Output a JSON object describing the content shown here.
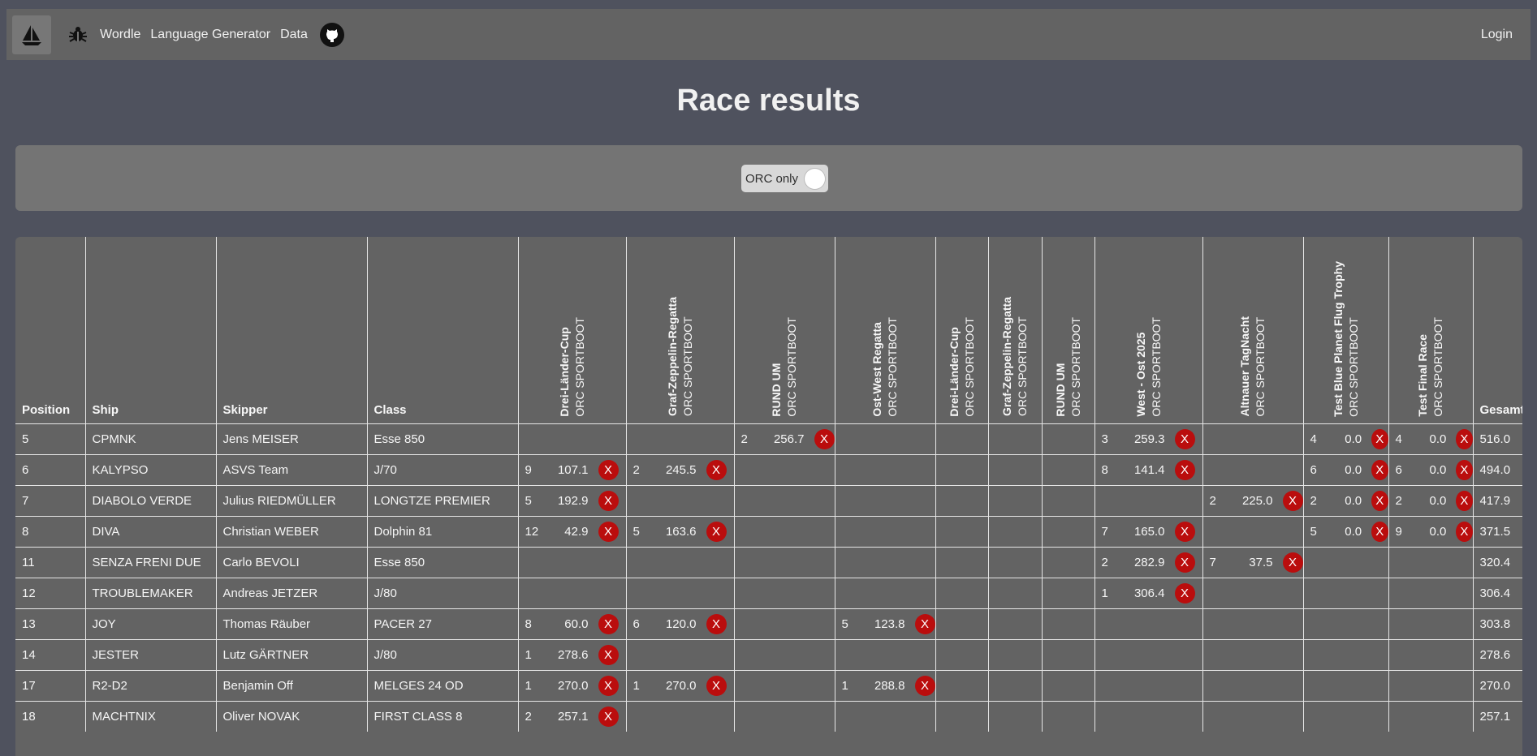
{
  "nav": {
    "links": [
      "Wordle",
      "Language Generator",
      "Data"
    ],
    "login": "Login"
  },
  "page": {
    "title": "Race results"
  },
  "filter": {
    "toggle_label": "ORC only"
  },
  "table": {
    "headers": {
      "position": "Position",
      "ship": "Ship",
      "skipper": "Skipper",
      "class": "Class",
      "total": "Gesamt"
    },
    "races": [
      {
        "name": "Drei-Länder-Cup",
        "sub": "ORC SPORTBOOT"
      },
      {
        "name": "Graf-Zeppelin-Regatta",
        "sub": "ORC SPORTBOOT"
      },
      {
        "name": "RUND UM",
        "sub": "ORC SPORTBOOT"
      },
      {
        "name": "Ost-West Regatta",
        "sub": "ORC SPORTBOOT"
      },
      {
        "name": "Drei-Länder-Cup",
        "sub": "ORC SPORTBOOT"
      },
      {
        "name": "Graf-Zeppelin-Regatta",
        "sub": "ORC SPORTBOOT"
      },
      {
        "name": "RUND UM",
        "sub": "ORC SPORTBOOT"
      },
      {
        "name": "West - Ost 2025",
        "sub": "ORC SPORTBOOT"
      },
      {
        "name": "Altnauer TagNacht",
        "sub": "ORC SPORTBOOT"
      },
      {
        "name": "Test Blue Planet Flug Trophy",
        "sub": "ORC SPORTBOOT"
      },
      {
        "name": "Test Final Race",
        "sub": "ORC SPORTBOOT"
      }
    ],
    "remove_label": "X",
    "rows": [
      {
        "position": "5",
        "ship": "CPMNK",
        "skipper": "Jens MEISER",
        "class": "Esse 850",
        "total": "516.0",
        "results": [
          null,
          null,
          [
            "2",
            "256.7"
          ],
          null,
          null,
          null,
          null,
          [
            "3",
            "259.3"
          ],
          null,
          [
            "4",
            "0.0"
          ],
          [
            "4",
            "0.0"
          ]
        ]
      },
      {
        "position": "6",
        "ship": "KALYPSO",
        "skipper": "ASVS Team",
        "class": "J/70",
        "total": "494.0",
        "results": [
          [
            "9",
            "107.1"
          ],
          [
            "2",
            "245.5"
          ],
          null,
          null,
          null,
          null,
          null,
          [
            "8",
            "141.4"
          ],
          null,
          [
            "6",
            "0.0"
          ],
          [
            "6",
            "0.0"
          ]
        ]
      },
      {
        "position": "7",
        "ship": "DIABOLO VERDE",
        "skipper": "Julius RIEDMÜLLER",
        "class": "LONGTZE PREMIER",
        "total": "417.9",
        "results": [
          [
            "5",
            "192.9"
          ],
          null,
          null,
          null,
          null,
          null,
          null,
          null,
          [
            "2",
            "225.0"
          ],
          [
            "2",
            "0.0"
          ],
          [
            "2",
            "0.0"
          ]
        ]
      },
      {
        "position": "8",
        "ship": "DIVA",
        "skipper": "Christian WEBER",
        "class": "Dolphin 81",
        "total": "371.5",
        "results": [
          [
            "12",
            "42.9"
          ],
          [
            "5",
            "163.6"
          ],
          null,
          null,
          null,
          null,
          null,
          [
            "7",
            "165.0"
          ],
          null,
          [
            "5",
            "0.0"
          ],
          [
            "9",
            "0.0"
          ]
        ]
      },
      {
        "position": "11",
        "ship": "SENZA FRENI DUE",
        "skipper": "Carlo BEVOLI",
        "class": "Esse 850",
        "total": "320.4",
        "results": [
          null,
          null,
          null,
          null,
          null,
          null,
          null,
          [
            "2",
            "282.9"
          ],
          [
            "7",
            "37.5"
          ],
          null,
          null
        ]
      },
      {
        "position": "12",
        "ship": "TROUBLEMAKER",
        "skipper": "Andreas JETZER",
        "class": "J/80",
        "total": "306.4",
        "results": [
          null,
          null,
          null,
          null,
          null,
          null,
          null,
          [
            "1",
            "306.4"
          ],
          null,
          null,
          null
        ]
      },
      {
        "position": "13",
        "ship": "JOY",
        "skipper": "Thomas Räuber",
        "class": "PACER 27",
        "total": "303.8",
        "results": [
          [
            "8",
            "60.0"
          ],
          [
            "6",
            "120.0"
          ],
          null,
          [
            "5",
            "123.8"
          ],
          null,
          null,
          null,
          null,
          null,
          null,
          null
        ]
      },
      {
        "position": "14",
        "ship": "JESTER",
        "skipper": "Lutz GÄRTNER",
        "class": "J/80",
        "total": "278.6",
        "results": [
          [
            "1",
            "278.6"
          ],
          null,
          null,
          null,
          null,
          null,
          null,
          null,
          null,
          null,
          null
        ]
      },
      {
        "position": "17",
        "ship": "R2-D2",
        "skipper": "Benjamin Off",
        "class": "MELGES 24 OD",
        "total": "270.0",
        "results": [
          [
            "1",
            "270.0"
          ],
          [
            "1",
            "270.0"
          ],
          null,
          [
            "1",
            "288.8"
          ],
          null,
          null,
          null,
          null,
          null,
          null,
          null
        ]
      },
      {
        "position": "18",
        "ship": "MACHTNIX",
        "skipper": "Oliver NOVAK",
        "class": "FIRST CLASS 8",
        "total": "257.1",
        "results": [
          [
            "2",
            "257.1"
          ],
          null,
          null,
          null,
          null,
          null,
          null,
          null,
          null,
          null,
          null
        ]
      }
    ]
  }
}
